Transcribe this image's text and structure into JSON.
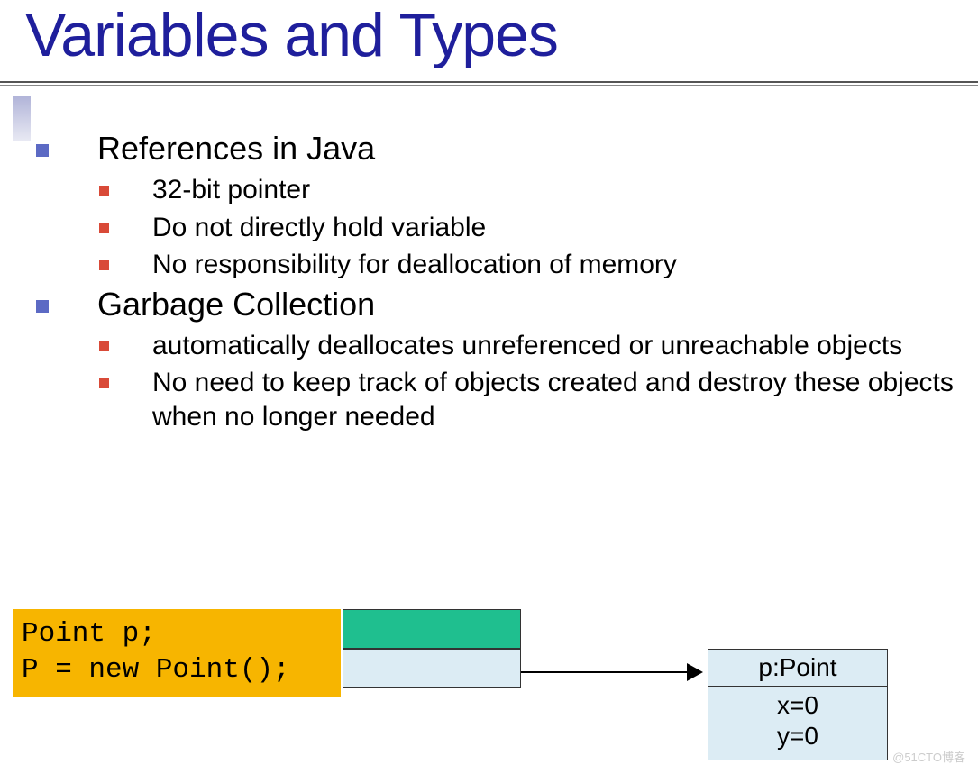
{
  "title": "Variables and Types",
  "sections": [
    {
      "heading": "References in Java",
      "items": [
        "32-bit pointer",
        "Do not directly hold variable",
        "No responsibility for deallocation of memory"
      ]
    },
    {
      "heading": "Garbage Collection",
      "items": [
        "automatically deallocates unreferenced or unreachable objects",
        "No need to keep track of objects created and destroy these objects when no longer needed"
      ]
    }
  ],
  "code": {
    "line1": "Point p;",
    "line2": "P = new Point();"
  },
  "object_box": {
    "header": "p:Point",
    "field1": "x=0",
    "field2": "y=0"
  },
  "watermark": "@51CTO博客"
}
